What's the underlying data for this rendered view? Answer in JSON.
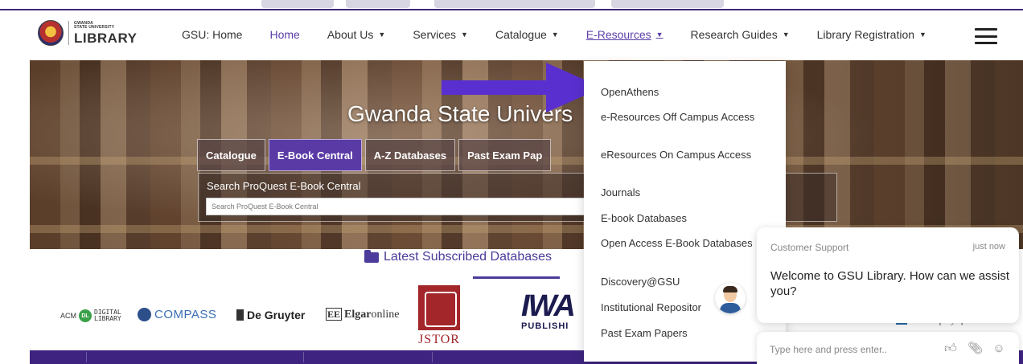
{
  "header": {
    "logo_small_1": "GWANDA",
    "logo_small_2": "STATE UNIVERSITY",
    "logo_big": "LIBRARY"
  },
  "nav": {
    "items": [
      {
        "label": "GSU: Home",
        "has_chevron": false
      },
      {
        "label": "Home",
        "has_chevron": false,
        "active": true
      },
      {
        "label": "About Us",
        "has_chevron": true
      },
      {
        "label": "Services",
        "has_chevron": true
      },
      {
        "label": "Catalogue",
        "has_chevron": true
      },
      {
        "label": "E-Resources",
        "has_chevron": true,
        "open": true
      },
      {
        "label": "Research Guides",
        "has_chevron": true
      },
      {
        "label": "Library Registration",
        "has_chevron": true
      }
    ],
    "chevron_glyph": "❯"
  },
  "hero": {
    "title": "Gwanda State Univers",
    "tabs": [
      "Catalogue",
      "E-Book Central",
      "A-Z Databases",
      "Past Exam Pap"
    ],
    "active_tab": "E-Book Central",
    "search_label": "Search ProQuest E-Book Central",
    "search_placeholder": "Search ProQuest E-Book Central"
  },
  "dropdown": {
    "items": [
      "OpenAthens",
      "e-Resources Off Campus Access",
      "eResources On Campus Access",
      "Journals",
      "E-book Databases",
      "Open Access E-Book Databases",
      "Discovery@GSU",
      "Institutional Repositor",
      "Past Exam Papers"
    ]
  },
  "latest": {
    "label": "Latest Subscribed Databases"
  },
  "logos": {
    "acm_prefix": "ACM",
    "acm_dl_badge": "DL",
    "acm_dl_line1": "DIGITAL",
    "acm_dl_line2": "LIBRARY",
    "compass": "COMPASS",
    "degruyter": "De Gruyter",
    "elgar_badge": "EE",
    "elgar_bold": "Elgar",
    "elgar_rest": "online",
    "jstor": "JSTOR",
    "iwa_mark": "IWA",
    "iwa_sub": "PUBLISHI"
  },
  "chat": {
    "header": "Customer Support",
    "time": "just now",
    "message": "Welcome to GSU Library. How can we assist you?",
    "input_placeholder": "Type here and press enter..",
    "behind_logo_text": "The Company of"
  },
  "colors": {
    "brand_purple": "#5b3ea8",
    "footer_purple": "#3e2480",
    "arrow_purple": "#5a2fcf"
  },
  "icons": {
    "folder": "folder-icon",
    "thumbs_up": "thumbs-up-icon",
    "attachment": "paperclip-icon",
    "emoji": "smiley-icon",
    "menu": "hamburger-menu-icon"
  }
}
